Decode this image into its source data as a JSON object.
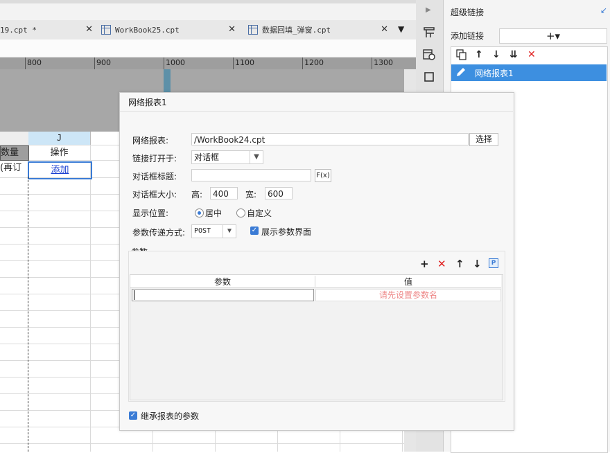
{
  "tabs": [
    {
      "label": "19.cpt *"
    },
    {
      "label": "WorkBook25.cpt"
    },
    {
      "label": "数据回填_弹窗.cpt"
    }
  ],
  "ruler": {
    "ticks": [
      "800",
      "900",
      "1000",
      "1100",
      "1200",
      "1300"
    ]
  },
  "sheet": {
    "column_j": "J",
    "cell_qty": "数量",
    "cell_op": "操作",
    "cell_reorder": "(再订",
    "cell_add": "添加"
  },
  "right_panel": {
    "title": "超级链接",
    "add_link_label": "添加链接",
    "add_button": "+▾",
    "items": [
      {
        "label": "网络报表1",
        "selected": true
      }
    ]
  },
  "dialog": {
    "title": "网络报表1",
    "report_label": "网络报表:",
    "report_value": "/WorkBook24.cpt",
    "choose_button": "选择",
    "open_in_label": "链接打开于:",
    "open_in_value": "对话框",
    "dialog_title_label": "对话框标题:",
    "dialog_title_value": "",
    "formula_button": "F(x)",
    "dialog_size_label": "对话框大小:",
    "height_label": "高:",
    "height_value": "400",
    "width_label": "宽:",
    "width_value": "600",
    "position_label": "显示位置:",
    "position_options": [
      "居中",
      "自定义"
    ],
    "position_selected": "居中",
    "param_method_label": "参数传递方式:",
    "param_method_value": "POST",
    "show_param_ui_label": "展示参数界面",
    "show_param_ui_checked": true,
    "params_group_label": "参数",
    "params_table": {
      "headers": [
        "参数",
        "值"
      ],
      "rows": [
        {
          "param": "",
          "value": "请先设置参数名"
        }
      ]
    },
    "inherit_label": "继承报表的参数",
    "inherit_checked": true
  },
  "colors": {
    "accent": "#3a7bd5",
    "selection": "#3d8fe0",
    "delete": "#e02020",
    "placeholder_value": "#ee8888"
  }
}
